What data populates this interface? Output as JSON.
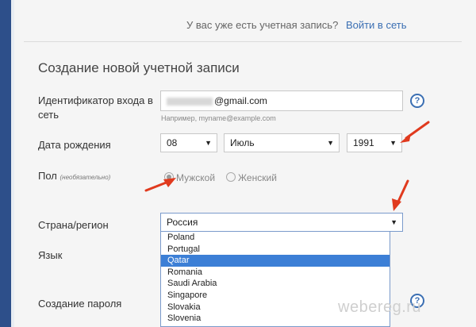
{
  "header": {
    "existing_account_text": "У вас уже есть учетная запись?",
    "signin_link": "Войти в сеть"
  },
  "form": {
    "title": "Создание новой учетной записи",
    "login": {
      "label": "Идентификатор входа в сеть",
      "value_suffix": "@gmail.com",
      "hint": "Например, myname@example.com",
      "help": "?"
    },
    "birthdate": {
      "label": "Дата рождения",
      "day": "08",
      "month": "Июль",
      "year": "1991"
    },
    "gender": {
      "label": "Пол",
      "optional": "(необязательно)",
      "male": "Мужской",
      "female": "Женский",
      "selected": "male"
    },
    "country": {
      "label": "Страна/регион",
      "value": "Россия",
      "options": [
        "Poland",
        "Portugal",
        "Qatar",
        "Romania",
        "Saudi Arabia",
        "Singapore",
        "Slovakia",
        "Slovenia"
      ],
      "highlighted": "Qatar"
    },
    "language": {
      "label": "Язык"
    },
    "password": {
      "label": "Создание пароля",
      "help": "?"
    }
  },
  "watermark": "webereg.ru",
  "colors": {
    "link": "#3b6fb3",
    "highlight": "#3c7fd6",
    "annotation_arrow": "#e03a1e"
  }
}
